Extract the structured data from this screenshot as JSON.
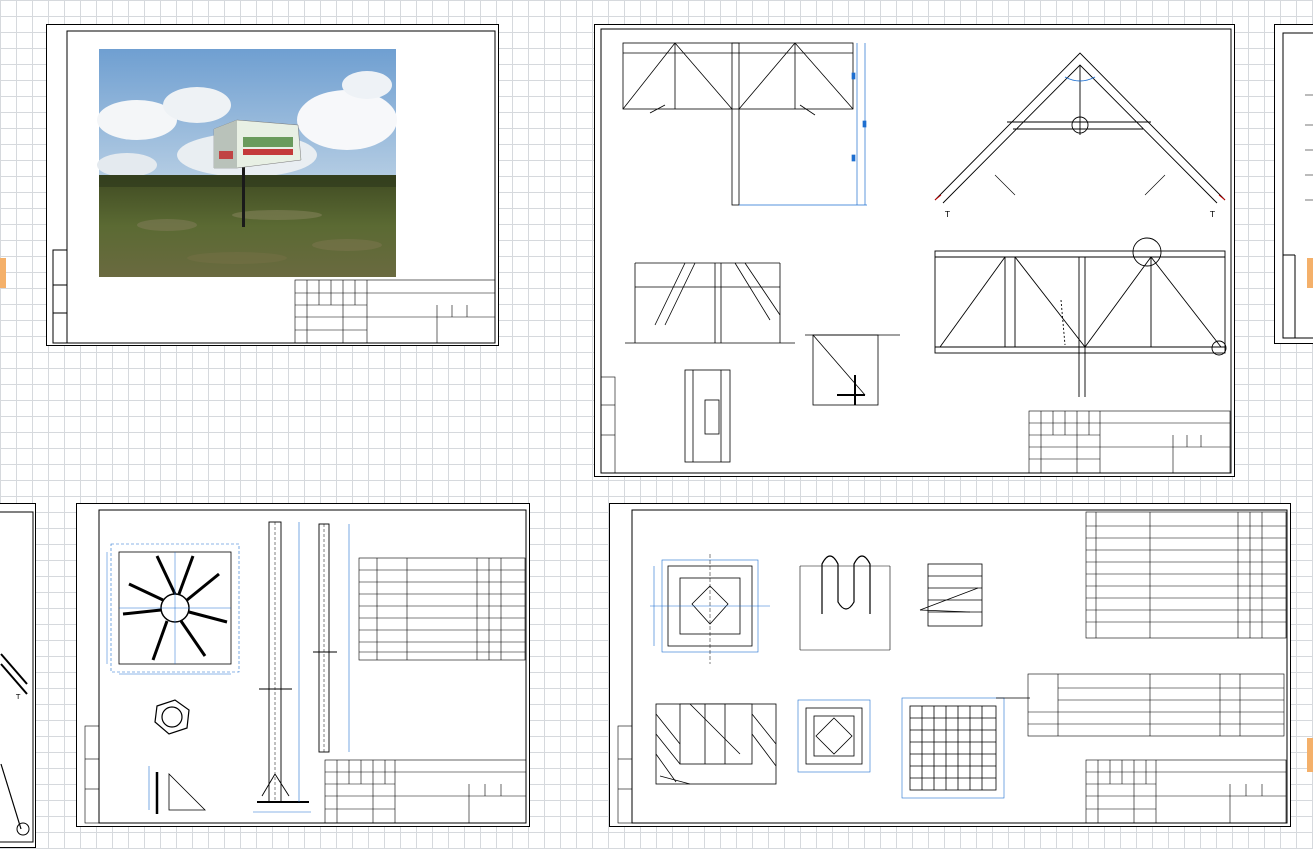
{
  "canvas": {
    "background": "#ffffff",
    "grid_color": "#d6d9dd",
    "line_color": "#000000",
    "dimension_color": "#1e6fd0",
    "accent_tab_color": "#f4b06a"
  },
  "sheets": [
    {
      "id": "photo-sheet",
      "content": "billboard-photograph",
      "interactable": true
    },
    {
      "id": "truss-sheet",
      "content": "billboard-truss-drawings",
      "interactable": true
    },
    {
      "id": "column-base-sheet",
      "content": "column-and-base-plate-drawings",
      "interactable": true
    },
    {
      "id": "foundation-sheet",
      "content": "foundation-and-anchor-bolt-drawings",
      "interactable": true
    }
  ],
  "photo": {
    "sky_color": "#8fb6dc",
    "ground_color": "#4f5a2c",
    "billboard_color": "#e8f0e4"
  }
}
